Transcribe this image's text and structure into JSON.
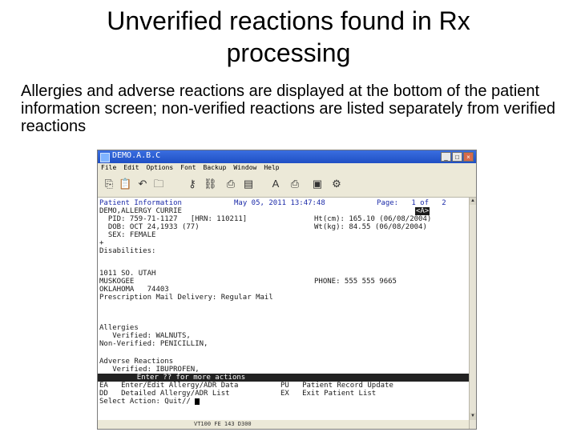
{
  "slide": {
    "title_line1": "Unverified reactions found in Rx",
    "title_line2": "processing",
    "body": "Allergies and adverse reactions are displayed at the bottom of the patient information screen; non-verified reactions are listed separately from verified reactions"
  },
  "window": {
    "title": "DEMO.A.B.C",
    "menu": [
      "File",
      "Edit",
      "Options",
      "Font",
      "Backup",
      "Window",
      "Help"
    ]
  },
  "toolbar_icons": [
    "copy-icon",
    "paste-icon",
    "undo-icon",
    "folder-icon",
    "key-icon",
    "link-icon",
    "print-icon",
    "open-icon",
    "spell-check-icon",
    "printer-icon",
    "disk-icon",
    "settings-icon"
  ],
  "terminal": {
    "line_header_left": "Patient Information",
    "line_header_date": "May 05, 2011 13:47:48",
    "line_header_page": "Page:   1 of   2",
    "patient_name": "DEMO,ALLERGY CURRIE",
    "patient_tag": "<A>",
    "pid": "  PID: 759-71-1127   [HRN: 110211]",
    "height": "Ht(cm): 165.10 (06/08/2004)",
    "dob": "  DOB: OCT 24,1933 (77)",
    "weight": "Wt(kg): 84.55 (06/08/2004)",
    "sex": "  SEX: FEMALE",
    "plus": "+",
    "disabilities": "Disabilities:",
    "address1": "1011 SO. UTAH",
    "address2": "MUSKOGEE",
    "phone": "PHONE: 555 555 9665",
    "address3": "OKLAHOMA   74403",
    "mail": "Prescription Mail Delivery: Regular Mail",
    "allergies_label": "Allergies",
    "allergies_verified": "   Verified: WALNUTS,",
    "allergies_nonverified": "Non-Verified: PENICILLIN,",
    "adverse_label": "Adverse Reactions",
    "adverse_verified": "   Verified: IBUPROFEN,",
    "more_actions": "         Enter ?? for more actions",
    "action1_left": "EA   Enter/Edit Allergy/ADR Data",
    "action1_right": "PU   Patient Record Update",
    "action2_left": "DD   Detailed Allergy/ADR List",
    "action2_right": "EX   Exit Patient List",
    "select_prompt": "Select Action: Quit// "
  },
  "statusbar": {
    "text": "VT100  FE   143  D300"
  }
}
